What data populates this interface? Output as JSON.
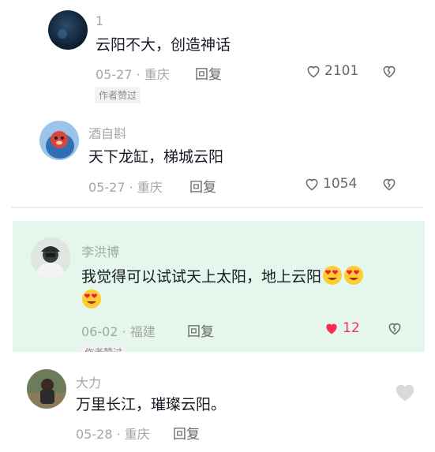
{
  "comments": [
    {
      "username": "1",
      "text": "云阳不大，创造神话",
      "date": "05-27",
      "location": "重庆",
      "reply_label": "回复",
      "likes": "2101",
      "badge": "作者赞过"
    },
    {
      "username": "酒自斟",
      "text": "天下龙缸，梯城云阳",
      "date": "05-27",
      "location": "重庆",
      "reply_label": "回复",
      "likes": "1054"
    },
    {
      "username": "李洪博",
      "text_line1": "我觉得可以试试天上太阳，地上云阳",
      "date": "06-02",
      "location": "福建",
      "reply_label": "回复",
      "likes": "12",
      "badge": "作者赞过"
    },
    {
      "username": "大力",
      "text": "万里长江，璀璨云阳。",
      "date": "05-28",
      "location": "重庆",
      "reply_label": "回复"
    }
  ],
  "meta_separator": "·",
  "colors": {
    "highlight_bg": "#e5f7ec",
    "liked_heart": "#fe2c55",
    "secondary_text": "#a6a6a6"
  },
  "icons": {
    "like": "heart-outline-icon",
    "liked": "heart-filled-icon",
    "dislike": "broken-heart-icon",
    "emoji": "heart-eyes-emoji-icon"
  }
}
